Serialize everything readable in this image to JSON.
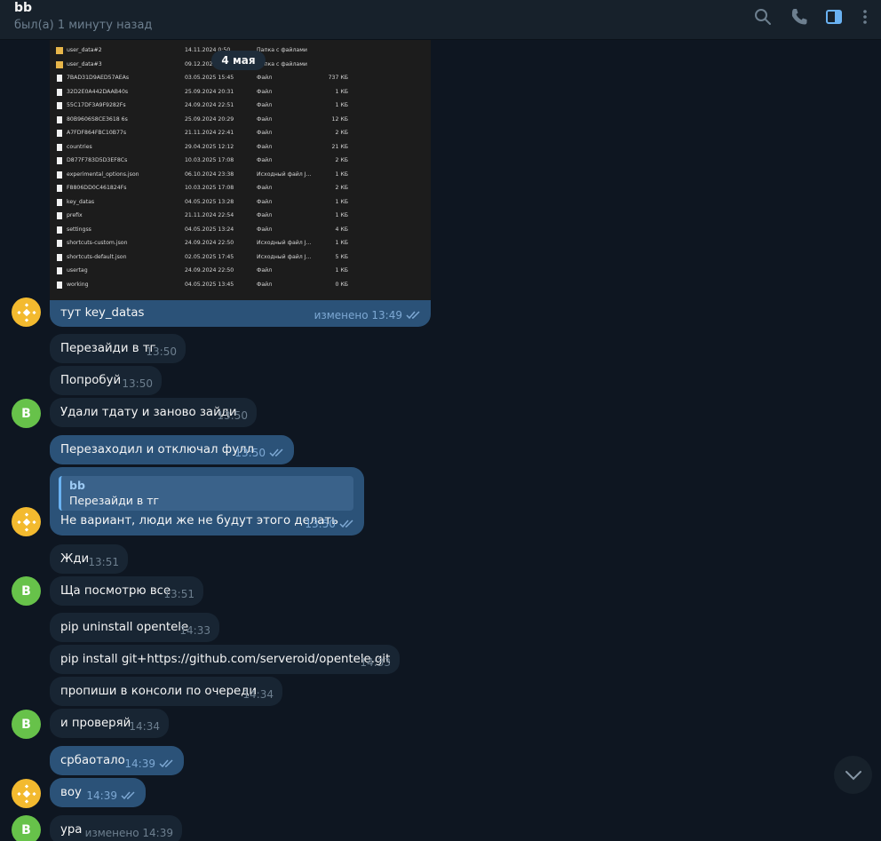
{
  "header": {
    "title": "bb",
    "status": "был(а) 1 минуту назад",
    "icons": [
      "search-icon",
      "phone-icon",
      "sidebar-toggle-icon",
      "more-icon"
    ]
  },
  "date_separator": "4 мая",
  "screenshot_files": [
    {
      "name": "user_data#2",
      "date": "14.11.2024 0:50",
      "type": "Папка с файлами",
      "size": "",
      "folder": true
    },
    {
      "name": "user_data#3",
      "date": "09.12.2024",
      "type": "Папка с файлами",
      "size": "",
      "folder": true
    },
    {
      "name": "7BAD31D9AED57AEAs",
      "date": "03.05.2025 15:45",
      "type": "Файл",
      "size": "737 КБ"
    },
    {
      "name": "32D2E0A442DAAB40s",
      "date": "25.09.2024 20:31",
      "type": "Файл",
      "size": "1 КБ"
    },
    {
      "name": "55C17DF3A9F9282Fs",
      "date": "24.09.2024 22:51",
      "type": "Файл",
      "size": "1 КБ"
    },
    {
      "name": "80B9606S8CE3618 6s",
      "date": "25.09.2024 20:29",
      "type": "Файл",
      "size": "12 КБ"
    },
    {
      "name": "A7FDF864FBC10B77s",
      "date": "21.11.2024 22:41",
      "type": "Файл",
      "size": "2 КБ"
    },
    {
      "name": "countries",
      "date": "29.04.2025 12:12",
      "type": "Файл",
      "size": "21 КБ"
    },
    {
      "name": "D877F783D5D3EF8Cs",
      "date": "10.03.2025 17:08",
      "type": "Файл",
      "size": "2 КБ"
    },
    {
      "name": "experimental_options.json",
      "date": "06.10.2024 23:38",
      "type": "Исходный файл J...",
      "size": "1 КБ"
    },
    {
      "name": "F8806DD0C461824Fs",
      "date": "10.03.2025 17:08",
      "type": "Файл",
      "size": "2 КБ"
    },
    {
      "name": "key_datas",
      "date": "04.05.2025 13:28",
      "type": "Файл",
      "size": "1 КБ"
    },
    {
      "name": "prefix",
      "date": "21.11.2024 22:54",
      "type": "Файл",
      "size": "1 КБ"
    },
    {
      "name": "settingss",
      "date": "04.05.2025 13:24",
      "type": "Файл",
      "size": "4 КБ"
    },
    {
      "name": "shortcuts-custom.json",
      "date": "24.09.2024 22:50",
      "type": "Исходный файл J...",
      "size": "1 КБ"
    },
    {
      "name": "shortcuts-default.json",
      "date": "02.05.2025 17:45",
      "type": "Исходный файл J...",
      "size": "5 КБ"
    },
    {
      "name": "usertag",
      "date": "24.09.2024 22:50",
      "type": "Файл",
      "size": "1 КБ"
    },
    {
      "name": "working",
      "date": "04.05.2025 13:45",
      "type": "Файл",
      "size": "0 КБ"
    }
  ],
  "messages": {
    "m1": {
      "text": "тут key_datas",
      "time": "изменено 13:49"
    },
    "m2": {
      "text": "Перезайди в тг",
      "time": "13:50"
    },
    "m3": {
      "text": "Попробуй",
      "time": "13:50"
    },
    "m4": {
      "text": "Удали тдату и заново зайди",
      "time": "13:50"
    },
    "m5": {
      "text": "Перезаходил и отключал фулл",
      "time": "13:50"
    },
    "m6": {
      "reply_name": "bb",
      "reply_text": "Перезайди в тг",
      "text": "Не вариант, люди же не будут этого делать",
      "time": "13:50"
    },
    "m7": {
      "text": "Жди",
      "time": "13:51"
    },
    "m8": {
      "text": "Ща посмотрю все",
      "time": "13:51"
    },
    "m9": {
      "text": "pip uninstall opentele",
      "time": "14:33"
    },
    "m10": {
      "text": "pip install git+https://github.com/serveroid/opentele.git",
      "time": "14:33"
    },
    "m11": {
      "text": "пропиши в консоли по очереди",
      "time": "14:34"
    },
    "m12": {
      "text": "и проверяй",
      "time": "14:34"
    },
    "m13": {
      "text": "србаотало",
      "time": "14:39"
    },
    "m14": {
      "text": "воу",
      "time": "14:39"
    },
    "m15": {
      "text": "ура",
      "time": "изменено 14:39"
    }
  },
  "avatars": {
    "contact_letter": "B"
  },
  "colors": {
    "background": "#0e1621",
    "incoming": "#182533",
    "outgoing": "#2b5278",
    "accent": "#6ab2f2",
    "contact_avatar": "#67c24a",
    "coin_avatar": "#f3ba2f"
  }
}
